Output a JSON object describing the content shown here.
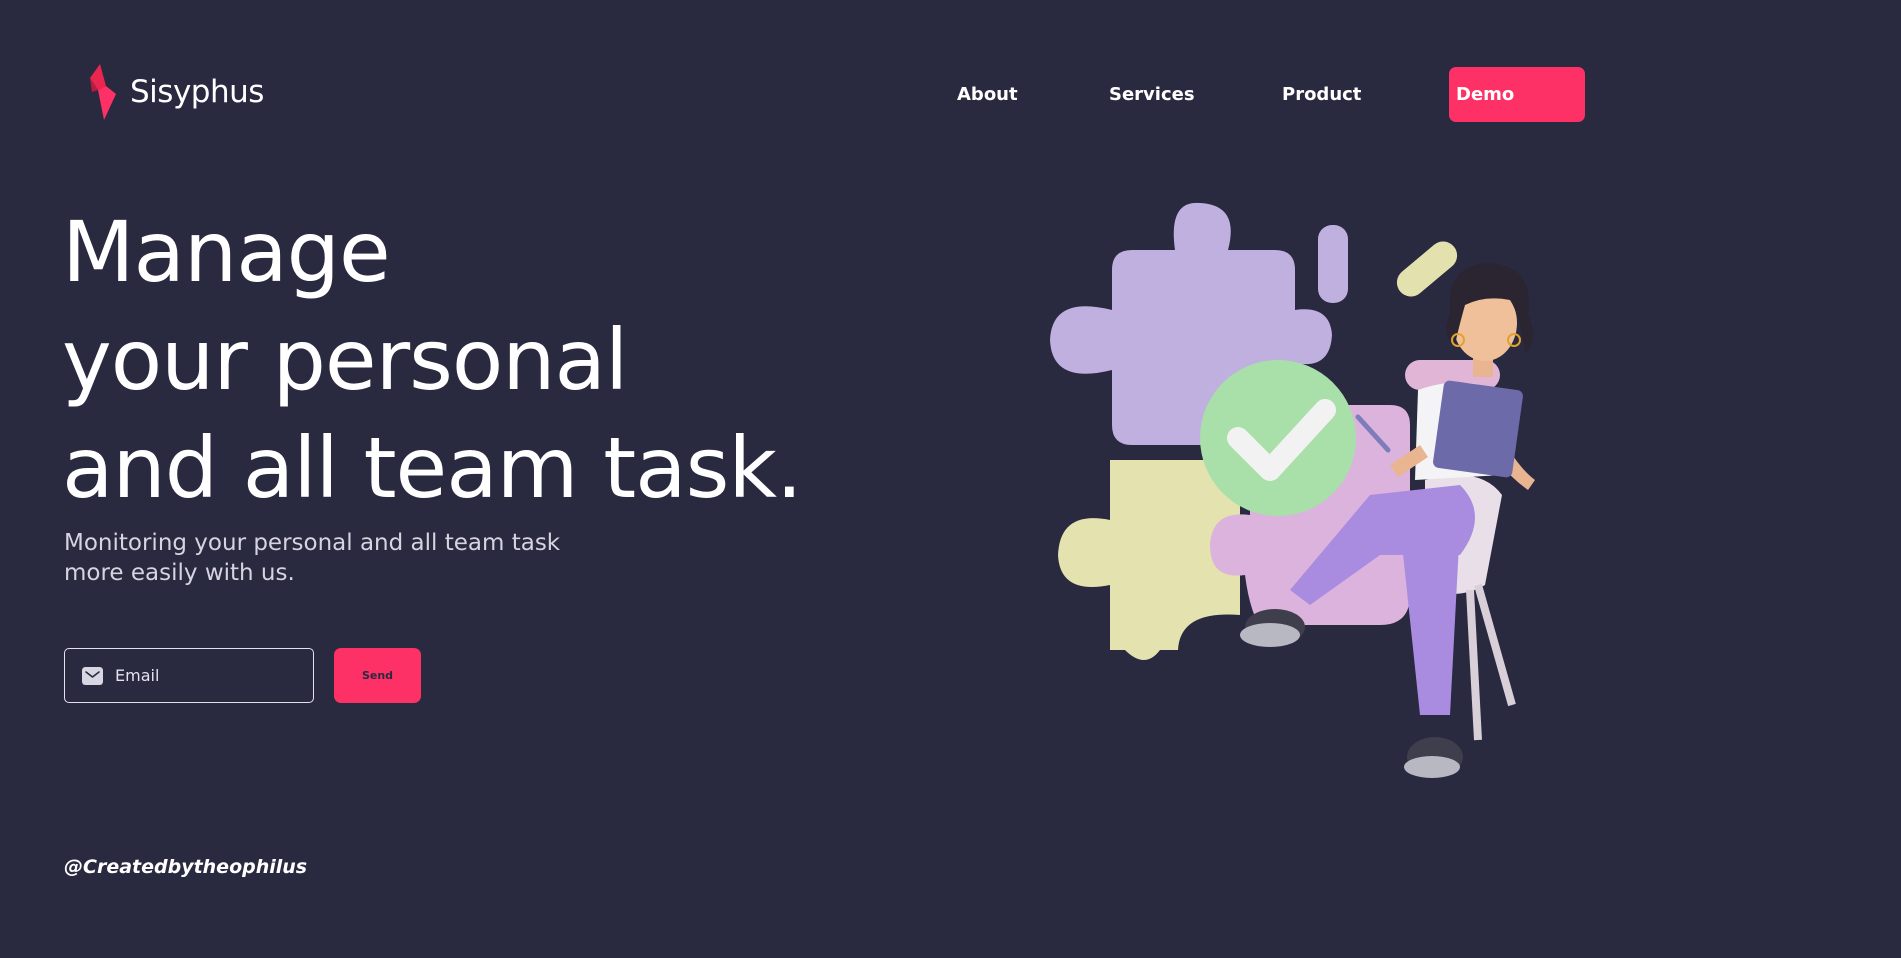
{
  "brand": {
    "name": "Sisyphus",
    "logo_icon": "lightning-bolt-icon",
    "accent_color": "#fd3166",
    "background_color": "#292940"
  },
  "nav": {
    "links": [
      "About",
      "Services",
      "Product"
    ],
    "demo_label": "Demo"
  },
  "hero": {
    "title_lines": [
      "Manage",
      "your personal",
      "and all team task."
    ],
    "subtitle_lines": [
      "Monitoring your personal and all team task",
      "more easily with us."
    ]
  },
  "signup": {
    "email_placeholder": "Email",
    "email_value": "",
    "email_icon": "envelope-icon",
    "send_label": "Send"
  },
  "footer": {
    "credit": "@Createdbytheophilus"
  },
  "illustration": {
    "description_icon": "woman-with-tablet-puzzle-illustration"
  }
}
